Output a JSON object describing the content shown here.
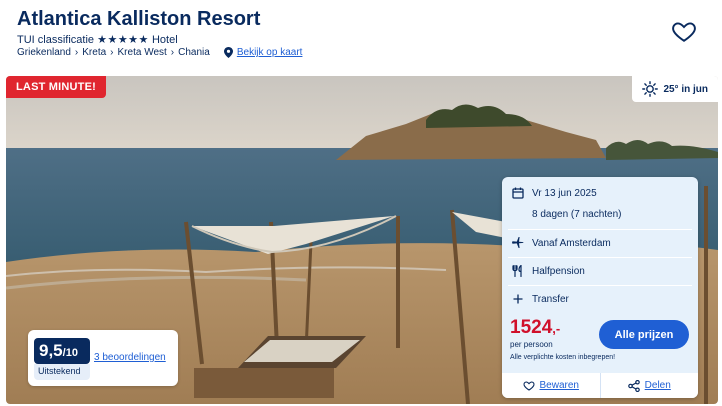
{
  "hotel": {
    "name": "Atlantica Kalliston Resort",
    "classification_prefix": "TUI classificatie",
    "classification_stars": "★★★★★",
    "classification_suffix": "Hotel",
    "star_rating": 5,
    "breadcrumb": [
      "Griekenland",
      "Kreta",
      "Kreta West",
      "Chania"
    ],
    "map_link": "Bekijk op kaart"
  },
  "hero": {
    "badge": "LAST MINUTE!",
    "weather": "25° in jun"
  },
  "rating": {
    "score": "9,5",
    "score_max": "/10",
    "label": "Uitstekend",
    "reviews": "3 beoordelingen"
  },
  "offer": {
    "date": "Vr 13 jun 2025",
    "duration": "8 dagen (7 nachten)",
    "departure": "Vanaf Amsterdam",
    "board": "Halfpension",
    "transfer": "Transfer",
    "price": "1524",
    "price_suffix": ",-",
    "per_person": "per persoon",
    "costs_note": "Alle verplichte kosten inbegrepen!",
    "cta": "Alle prijzen",
    "save": "Bewaren",
    "share": "Delen"
  },
  "colors": {
    "brand_navy": "#092a5e",
    "link_blue": "#1f5fd4",
    "price_red": "#d0102b",
    "badge_red": "#e0262f",
    "card_bg": "#e6f1fb"
  },
  "icons": [
    "heart-icon",
    "map-pin-icon",
    "sun-icon",
    "calendar-icon",
    "plane-icon",
    "cutlery-icon",
    "plus-icon",
    "share-icon"
  ]
}
